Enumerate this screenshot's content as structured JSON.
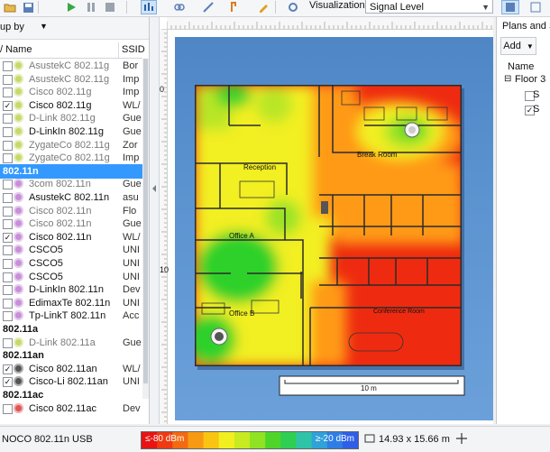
{
  "toolbar": {
    "visualization_label": "Visualization:",
    "visualization_value": "Signal Level"
  },
  "left_panel": {
    "group_by": "up by",
    "columns": {
      "name": "/ Name",
      "ssid": "SSID"
    },
    "rows": [
      {
        "type": "item",
        "checked": false,
        "name": "AsustekC 802.11g",
        "ssid": "Bor",
        "color": "#c7d96b",
        "style": "dim"
      },
      {
        "type": "item",
        "checked": false,
        "name": "AsustekC 802.11g",
        "ssid": "Imp",
        "color": "#c7d96b",
        "style": "dim",
        "ssid_style": "red"
      },
      {
        "type": "item",
        "checked": false,
        "name": "Cisco 802.11g",
        "ssid": "Imp",
        "color": "#c7d96b",
        "style": "dim",
        "ssid_style": "red"
      },
      {
        "type": "item",
        "checked": true,
        "name": "Cisco 802.11g",
        "ssid": "WL/",
        "color": "#c7d96b",
        "style": ""
      },
      {
        "type": "item",
        "checked": false,
        "name": "D-Link 802.11g",
        "ssid": "Gue",
        "color": "#c7d96b",
        "style": "dim"
      },
      {
        "type": "item",
        "checked": false,
        "name": "D-LinkIn 802.11g",
        "ssid": "Gue",
        "color": "#c7d96b",
        "style": ""
      },
      {
        "type": "item",
        "checked": false,
        "name": "ZygateCo 802.11g",
        "ssid": "Zor",
        "color": "#c7d96b",
        "style": "dim"
      },
      {
        "type": "item",
        "checked": false,
        "name": "ZygateCo 802.11g",
        "ssid": "Imp",
        "color": "#c7d96b",
        "style": "dim",
        "ssid_style": "red"
      },
      {
        "type": "group",
        "label": "802.11n",
        "selected": true
      },
      {
        "type": "item",
        "checked": false,
        "name": "3com 802.11n",
        "ssid": "Gue",
        "color": "#c88fd8",
        "style": "dim"
      },
      {
        "type": "item",
        "checked": false,
        "name": "AsustekC 802.11n",
        "ssid": "asu",
        "color": "#c88fd8",
        "style": ""
      },
      {
        "type": "item",
        "checked": false,
        "name": "Cisco 802.11n",
        "ssid": "Flo",
        "color": "#c88fd8",
        "style": "dim"
      },
      {
        "type": "item",
        "checked": false,
        "name": "Cisco 802.11n",
        "ssid": "Gue",
        "color": "#c88fd8",
        "style": "dim"
      },
      {
        "type": "item",
        "checked": true,
        "name": "Cisco 802.11n",
        "ssid": "WL/",
        "color": "#c88fd8",
        "style": ""
      },
      {
        "type": "item",
        "checked": false,
        "name": "CSCO5",
        "ssid": "UNI",
        "color": "#c88fd8",
        "style": ""
      },
      {
        "type": "item",
        "checked": false,
        "name": "CSCO5",
        "ssid": "UNI",
        "color": "#c88fd8",
        "style": ""
      },
      {
        "type": "item",
        "checked": false,
        "name": "CSCO5",
        "ssid": "UNI",
        "color": "#c88fd8",
        "style": ""
      },
      {
        "type": "item",
        "checked": false,
        "name": "D-LinkIn 802.11n",
        "ssid": "Dev",
        "color": "#c88fd8",
        "style": ""
      },
      {
        "type": "item",
        "checked": false,
        "name": "EdimaxTe 802.11n",
        "ssid": "UNI",
        "color": "#c88fd8",
        "style": ""
      },
      {
        "type": "item",
        "checked": false,
        "name": "Tp-LinkT 802.11n",
        "ssid": "Acc",
        "color": "#c88fd8",
        "style": ""
      },
      {
        "type": "group",
        "label": "802.11a",
        "selected": false
      },
      {
        "type": "item",
        "checked": false,
        "name": "D-Link 802.11a",
        "ssid": "Gue",
        "color": "#c7d96b",
        "style": "dim"
      },
      {
        "type": "group",
        "label": "802.11an",
        "selected": false
      },
      {
        "type": "item",
        "checked": true,
        "name": "Cisco 802.11an",
        "ssid": "WL/",
        "color": "#555555",
        "style": ""
      },
      {
        "type": "item",
        "checked": true,
        "name": "Cisco-Li 802.11an",
        "ssid": "UNI",
        "color": "#555555",
        "style": ""
      },
      {
        "type": "group",
        "label": "802.11ac",
        "selected": false
      },
      {
        "type": "item",
        "checked": false,
        "name": "Cisco 802.11ac",
        "ssid": "Dev",
        "color": "#e05555",
        "style": ""
      }
    ]
  },
  "canvas": {
    "ruler_ticks": [
      "0",
      "10"
    ],
    "rooms": {
      "reception": "Reception",
      "break_room": "Break Room",
      "office_a": "Office A",
      "office_b": "Office B",
      "conference": "Conference Room"
    },
    "scale_label": "10 m"
  },
  "right_panel": {
    "title": "Plans and St",
    "add_label": "Add",
    "name_header": "Name",
    "floor": "Floor 3",
    "items": [
      "S",
      "S"
    ]
  },
  "status_bar": {
    "adapter": "NOCO 802.11n USB",
    "legend_low": "≤-80 dBm",
    "legend_high": "≥-20 dBm",
    "dimensions": "14.93 x 15.66 m"
  },
  "colors": {
    "accent": "#3399ff",
    "heat_red": "#f21a10",
    "heat_green": "#2ed12a",
    "heat_yellow": "#f2ef20",
    "plan_bg": "#5b93d0"
  }
}
